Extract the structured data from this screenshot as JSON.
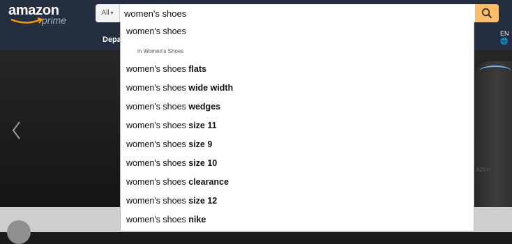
{
  "brand": {
    "name": "amazon",
    "tagline": "prime"
  },
  "search": {
    "category": "All",
    "value": "women's shoes"
  },
  "nav": {
    "departments_label": "Depa"
  },
  "lang": {
    "code": "EN"
  },
  "suggestions": {
    "first": "women's shoes",
    "first_scope": "in Women's Shoes",
    "items": [
      {
        "base": "women's shoes",
        "suffix": "flats"
      },
      {
        "base": "women's shoes",
        "suffix": "wide width"
      },
      {
        "base": "women's shoes",
        "suffix": "wedges"
      },
      {
        "base": "women's shoes",
        "suffix": "size 11"
      },
      {
        "base": "women's shoes",
        "suffix": "size 9"
      },
      {
        "base": "women's shoes",
        "suffix": "size 10"
      },
      {
        "base": "women's shoes",
        "suffix": "clearance"
      },
      {
        "base": "women's shoes",
        "suffix": "size 12"
      },
      {
        "base": "women's shoes",
        "suffix": "nike"
      }
    ]
  },
  "hero": {
    "watermark": "azon"
  },
  "colors": {
    "topbar": "#232f3e",
    "search_button": "#febd69",
    "smile": "#ff9900"
  }
}
